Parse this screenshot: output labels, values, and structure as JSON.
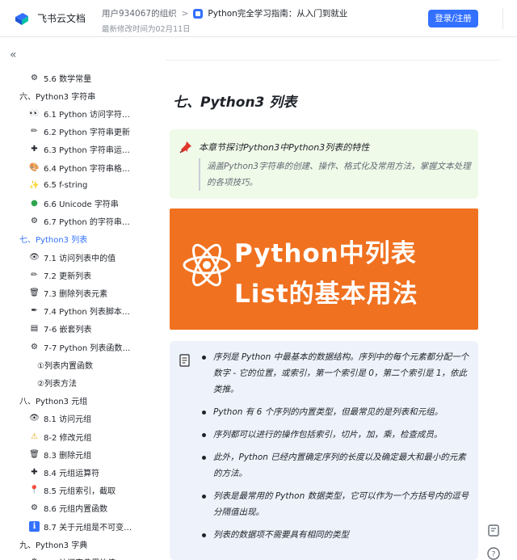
{
  "header": {
    "brand": "飞书云文档",
    "crumb_org": "用户934067的组织",
    "crumb_sep": ">",
    "crumb_doc": "Python完全学习指南：从入门到就业",
    "modified": "最新修改时间为02月11日",
    "login_label": "登录/注册"
  },
  "sidebar": {
    "collapse_glyph": "«",
    "items": [
      {
        "text": "5.6 数学常量",
        "icon": "gear-icon",
        "glyph": "⚙",
        "level": 2
      },
      {
        "text": "六、Python3 字符串",
        "icon": "",
        "glyph": "",
        "level": 1
      },
      {
        "text": "6.1 Python 访问字符…",
        "icon": "eyes-icon",
        "glyph": "👀",
        "level": 2
      },
      {
        "text": "6.2 Python 字符串更新",
        "icon": "pencil-icon",
        "glyph": "✏",
        "level": 2
      },
      {
        "text": "6.3 Python 字符串运…",
        "icon": "plus-icon",
        "glyph": "✚",
        "level": 2
      },
      {
        "text": "6.4 Python 字符串格…",
        "icon": "palette-icon",
        "glyph": "🎨",
        "level": 2
      },
      {
        "text": "6.5 f-string",
        "icon": "sparkle-icon",
        "glyph": "✨",
        "level": 2
      },
      {
        "text": "6.6 Unicode 字符串",
        "icon": "green-circle-icon",
        "glyph": "●",
        "level": 2
      },
      {
        "text": "6.7 Python 的字符串…",
        "icon": "gear-icon",
        "glyph": "⚙",
        "level": 2
      },
      {
        "text": "七、Python3 列表",
        "icon": "",
        "glyph": "",
        "level": 1,
        "active": true
      },
      {
        "text": "7.1 访问列表中的值",
        "icon": "eye-icon",
        "glyph": "👁",
        "level": 2
      },
      {
        "text": "7.2 更新列表",
        "icon": "pencil-icon",
        "glyph": "✏",
        "level": 2
      },
      {
        "text": "7.3 删除列表元素",
        "icon": "trash-icon",
        "glyph": "🗑",
        "level": 2
      },
      {
        "text": "7.4 Python 列表脚本…",
        "icon": "pen-icon",
        "glyph": "✒",
        "level": 2
      },
      {
        "text": "7-6 嵌套列表",
        "icon": "stack-icon",
        "glyph": "▤",
        "level": 2
      },
      {
        "text": "7-7 Python 列表函数…",
        "icon": "gear-icon",
        "glyph": "⚙",
        "level": 2
      },
      {
        "text": "①列表内置函数",
        "icon": "",
        "glyph": "",
        "level": 3
      },
      {
        "text": "②列表方法",
        "icon": "",
        "glyph": "",
        "level": 3
      },
      {
        "text": "八、Python3 元组",
        "icon": "",
        "glyph": "",
        "level": 1
      },
      {
        "text": "8.1 访问元组",
        "icon": "eye-icon",
        "glyph": "👁",
        "level": 2
      },
      {
        "text": "8-2 修改元组",
        "icon": "warning-icon",
        "glyph": "⚠",
        "level": 2
      },
      {
        "text": "8.3 删除元组",
        "icon": "trash-icon",
        "glyph": "🗑",
        "level": 2
      },
      {
        "text": "8.4 元组运算符",
        "icon": "plus-icon",
        "glyph": "✚",
        "level": 2
      },
      {
        "text": "8.5 元组索引，截取",
        "icon": "pin-icon",
        "glyph": "📍",
        "level": 2
      },
      {
        "text": "8.6 元组内置函数",
        "icon": "gear-icon",
        "glyph": "⚙",
        "level": 2
      },
      {
        "text": "8.7 关于元组是不可变…",
        "icon": "info-icon",
        "glyph": "ℹ",
        "level": 2
      },
      {
        "text": "九、Python3 字典",
        "icon": "",
        "glyph": "",
        "level": 1
      },
      {
        "text": "9.1 访问字典里的值",
        "icon": "gear-icon",
        "glyph": "⚙",
        "level": 2
      }
    ]
  },
  "main": {
    "section_title": "七、Python3 列表",
    "callout": {
      "title": "本章节探讨Python3中Python3列表的特性",
      "quote": "涵盖Python3字符串的创建、操作、格式化及常用方法，掌握文本处理的各项技巧。"
    },
    "banner": {
      "line1": "Python中列表",
      "line2": "List的基本用法"
    },
    "bullets": [
      "序列是 Python 中最基本的数据结构。序列中的每个元素都分配一个数字 - 它的位置，或索引，第一个索引是 0，第二个索引是 1，依此类推。",
      "Python 有 6 个序列的内置类型，但最常见的是列表和元组。",
      "序列都可以进行的操作包括索引，切片，加，乘，检查成员。",
      "此外，Python 已经内置确定序列的长度以及确定最大和最小的元素的方法。",
      "列表是最常用的 Python 数据类型，它可以作为一个方括号内的逗号分隔值出现。",
      "列表的数据项不需要具有相同的类型"
    ]
  },
  "colors": {
    "accent": "#3370ff",
    "callout_bg": "#effae9",
    "banner_bg": "#f07120",
    "note_bg": "#eef2fb"
  }
}
